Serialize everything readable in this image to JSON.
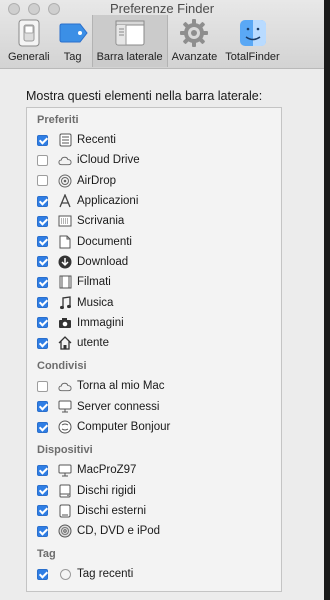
{
  "window": {
    "title": "Preferenze Finder",
    "tabs": [
      {
        "id": "generali",
        "label": "Generali",
        "icon": "switch-icon"
      },
      {
        "id": "tag",
        "label": "Tag",
        "icon": "tag-icon"
      },
      {
        "id": "barra",
        "label": "Barra laterale",
        "icon": "sidebar-icon",
        "active": true
      },
      {
        "id": "avanzate",
        "label": "Avanzate",
        "icon": "gear-icon"
      },
      {
        "id": "totalfinder",
        "label": "TotalFinder",
        "icon": "finder-icon"
      }
    ]
  },
  "main": {
    "heading": "Mostra questi elementi nella barra laterale:",
    "sections": [
      {
        "title": "Preferiti",
        "items": [
          {
            "label": "Recenti",
            "checked": true,
            "icon": "recents-icon"
          },
          {
            "label": "iCloud Drive",
            "checked": false,
            "icon": "cloud-icon"
          },
          {
            "label": "AirDrop",
            "checked": false,
            "icon": "airdrop-icon"
          },
          {
            "label": "Applicazioni",
            "checked": true,
            "icon": "applications-icon"
          },
          {
            "label": "Scrivania",
            "checked": true,
            "icon": "desktop-icon"
          },
          {
            "label": "Documenti",
            "checked": true,
            "icon": "document-icon"
          },
          {
            "label": "Download",
            "checked": true,
            "icon": "download-icon"
          },
          {
            "label": "Filmati",
            "checked": true,
            "icon": "film-icon"
          },
          {
            "label": "Musica",
            "checked": true,
            "icon": "music-icon"
          },
          {
            "label": "Immagini",
            "checked": true,
            "icon": "camera-icon"
          },
          {
            "label": "utente",
            "checked": true,
            "icon": "home-icon"
          }
        ]
      },
      {
        "title": "Condivisi",
        "items": [
          {
            "label": "Torna al mio Mac",
            "checked": false,
            "icon": "cloud-icon"
          },
          {
            "label": "Server connessi",
            "checked": true,
            "icon": "monitor-icon"
          },
          {
            "label": "Computer Bonjour",
            "checked": true,
            "icon": "bonjour-icon"
          }
        ]
      },
      {
        "title": "Dispositivi",
        "items": [
          {
            "label": "MacProZ97",
            "checked": true,
            "icon": "monitor-icon"
          },
          {
            "label": "Dischi rigidi",
            "checked": true,
            "icon": "hard-disk-icon"
          },
          {
            "label": "Dischi esterni",
            "checked": true,
            "icon": "external-disk-icon"
          },
          {
            "label": "CD, DVD e iPod",
            "checked": true,
            "icon": "optical-disc-icon"
          }
        ]
      },
      {
        "title": "Tag",
        "items": [
          {
            "label": "Tag recenti",
            "checked": true,
            "icon": "tag-circle-icon"
          }
        ]
      }
    ]
  }
}
